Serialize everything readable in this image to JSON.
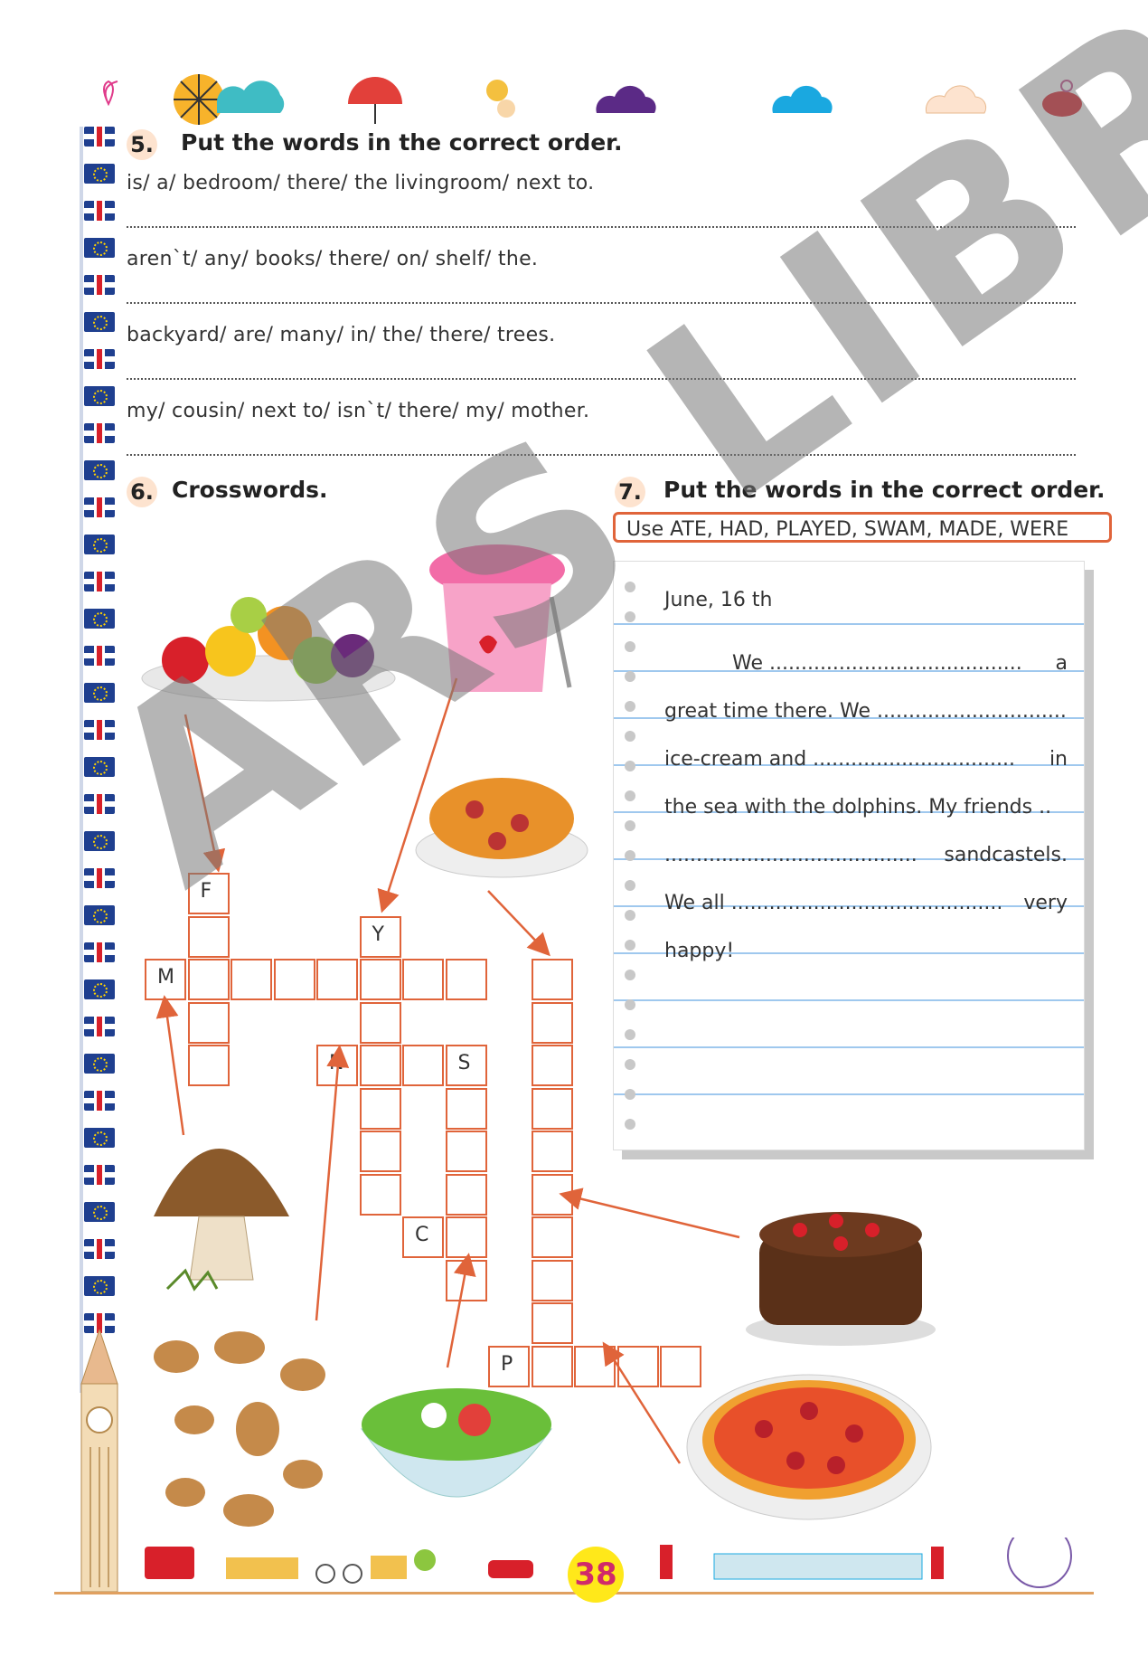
{
  "section5": {
    "number": "5.",
    "title": "Put the words in the correct order.",
    "lines": [
      "is/ a/ bedroom/ there/ the livingroom/ next to.",
      "aren`t/ any/ books/ there/ on/ shelf/ the.",
      "backyard/ are/ many/ in/ the/ there/ trees.",
      "my/ cousin/ next to/ isn`t/ there/ my/ mother."
    ]
  },
  "section6": {
    "number": "6.",
    "title": "Crosswords.",
    "letters": {
      "f": "F",
      "m": "M",
      "y": "Y",
      "n": "N",
      "s": "S",
      "c": "C",
      "p": "P"
    }
  },
  "section7": {
    "number": "7.",
    "title": "Put the words in the correct order.",
    "use_box": "Use ATE, HAD, PLAYED, SWAM, MADE, WERE",
    "date": "June, 16 th",
    "text_lines": [
      [
        "We ........................................",
        "a"
      ],
      [
        "great time there. We ..............................",
        ""
      ],
      [
        "ice-cream and ................................",
        "in"
      ],
      [
        "the sea with the dolphins. My friends ..",
        ""
      ],
      [
        "........................................",
        "sandcastels."
      ],
      [
        "We all ...........................................",
        "very"
      ],
      [
        "happy!",
        ""
      ]
    ]
  },
  "watermark": "ARS LIBRI",
  "page_number": "38",
  "colors": {
    "accent": "#e0643a",
    "number_badge": "#fde3cf",
    "page_badge": "#ffe81a",
    "notebook_lines": "#9fc8ee"
  },
  "icons": [
    "sun-icon",
    "rain-cloud-icon",
    "umbrella-icon",
    "bird-icon",
    "purple-cloud-icon",
    "blue-cloud-icon",
    "peach-cloud-icon",
    "teapot-icon",
    "big-ben-icon",
    "fruit-bowl-icon",
    "strawberry-yogurt-icon",
    "spaghetti-icon",
    "mushroom-icon",
    "cake-icon",
    "nuts-icon",
    "salad-icon",
    "pizza-icon",
    "bus-icon",
    "bicycle-icon",
    "ferris-wheel-icon"
  ]
}
